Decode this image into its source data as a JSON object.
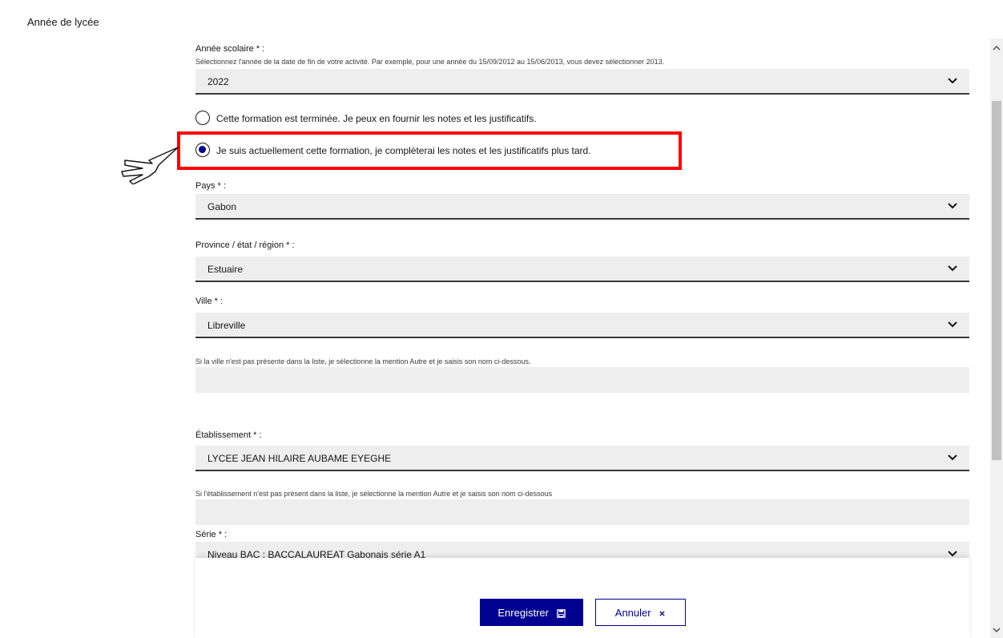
{
  "section": {
    "title": "Année de lycée"
  },
  "annee": {
    "label": "Année scolaire * :",
    "hint": "Sélectionnez l'année de la date de fin de votre activité. Par exemple, pour une année du 15/09/2012 au 15/06/2013, vous devez sélectionner 2013.",
    "value": "2022"
  },
  "formation": {
    "options": [
      {
        "label": "Cette formation est terminée. Je peux en fournir les notes et les justificatifs.",
        "selected": false
      },
      {
        "label": "Je suis actuellement cette formation, je complèterai les notes et les justificatifs plus tard.",
        "selected": true
      }
    ]
  },
  "pays": {
    "label": "Pays * :",
    "value": "Gabon"
  },
  "province": {
    "label": "Province / état / région * :",
    "value": "Estuaire"
  },
  "ville": {
    "label": "Ville * :",
    "value": "Libreville",
    "other_hint": "Si la ville n'est pas présente dans la liste, je sélectionne la mention Autre et je saisis son nom ci-dessous.",
    "other_value": ""
  },
  "etablissement": {
    "label": "Établissement * :",
    "value": "LYCEE JEAN HILAIRE AUBAME EYEGHE",
    "other_hint": "Si l'établissement n'est pas présent dans la liste, je sélectionne la mention Autre et je saisis son nom ci-dessous",
    "other_value": ""
  },
  "serie": {
    "label": "Série * :",
    "value": "Niveau BAC : BACCALAUREAT Gabonais série A1"
  },
  "actions": {
    "save_label": "Enregistrer",
    "cancel_label": "Annuler"
  },
  "colors": {
    "primary": "#000091",
    "highlight": "#ff0000",
    "field_bg": "#eeeeee"
  },
  "icons": {
    "chevron": "chevron-down-icon",
    "save": "floppy-disk-icon",
    "cancel": "close-icon",
    "pointer": "hand-pointer-icon"
  }
}
